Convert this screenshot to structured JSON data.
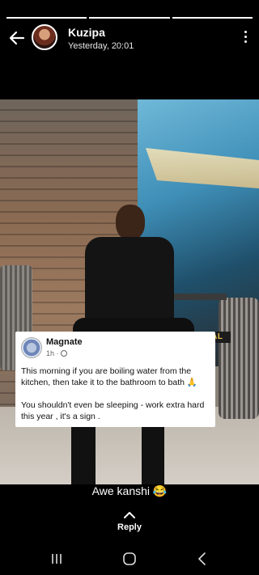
{
  "story": {
    "progress": [
      1,
      1,
      1
    ]
  },
  "header": {
    "name": "Kuzipa",
    "time": "Yesterday, 20:01"
  },
  "watermark": {
    "text": "ZAM VIRAL"
  },
  "post_card": {
    "author": "Magnate",
    "time": "1h ·",
    "paragraph1": "This morning if you are boiling water from the kitchen, then take it to the bathroom to bath 🙏",
    "paragraph2": "You shouldn't even be sleeping  - work extra hard this year , it's a sign ."
  },
  "caption": {
    "text": "Awe kanshi 😂"
  },
  "reply": {
    "label": "Reply"
  },
  "navbar": {
    "icons": [
      "recent-apps-icon",
      "home-icon",
      "back-icon"
    ]
  },
  "colors": {
    "background": "#000000",
    "watermark": "#e7c14a"
  }
}
